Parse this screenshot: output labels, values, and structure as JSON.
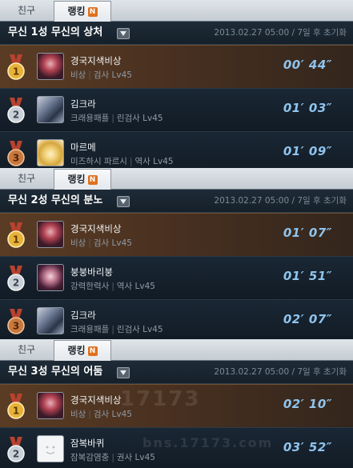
{
  "panels": [
    {
      "tabs": {
        "friend": "친구",
        "ranking": "랭킹",
        "badge": "N"
      },
      "title": "무신 1성 무신의 상처",
      "reset_info": "2013.02.27 05:00 / 7일 후 초기화",
      "rows": [
        {
          "rank": "1",
          "name": "경국지색비상",
          "guild": "비상",
          "cls": "검사 Lv45",
          "time": "00′ 44″"
        },
        {
          "rank": "2",
          "name": "김크라",
          "guild": "크래용패플",
          "cls": "린검사 Lv45",
          "time": "01′ 03″"
        },
        {
          "rank": "3",
          "name": "마르메",
          "guild": "미즈하시 파르시",
          "cls": "역사 Lv45",
          "time": "01′ 09″"
        }
      ]
    },
    {
      "tabs": {
        "friend": "친구",
        "ranking": "랭킹",
        "badge": "N"
      },
      "title": "무신 2성 무신의 분노",
      "reset_info": "2013.02.27 05:00 / 7일 후 초기화",
      "rows": [
        {
          "rank": "1",
          "name": "경국지색비상",
          "guild": "비상",
          "cls": "검사 Lv45",
          "time": "01′ 07″"
        },
        {
          "rank": "2",
          "name": "붕붕바리붕",
          "guild": "강력한력사",
          "cls": "역사 Lv45",
          "time": "01′ 51″"
        },
        {
          "rank": "3",
          "name": "김크라",
          "guild": "크래용패플",
          "cls": "린검사 Lv45",
          "time": "02′ 07″"
        }
      ]
    },
    {
      "tabs": {
        "friend": "친구",
        "ranking": "랭킹",
        "badge": "N"
      },
      "title": "무신 3성 무신의 어둠",
      "reset_info": "2013.02.27 05:00 / 7일 후 초기화",
      "rows": [
        {
          "rank": "1",
          "name": "경국지색비상",
          "guild": "비상",
          "cls": "검사 Lv45",
          "time": "02′ 10″"
        },
        {
          "rank": "2",
          "name": "잠복바퀴",
          "guild": "잠복감염충",
          "cls": "권사 Lv45",
          "time": "03′ 52″"
        }
      ]
    }
  ],
  "watermark": {
    "line1": "17173",
    "line2": "bns.17173.com"
  },
  "colors": {
    "gold": "#e8b23a",
    "silver": "#c9d0d6",
    "bronze": "#c9783c",
    "time": "#8fc4ee",
    "badge": "#e0701e"
  },
  "icons": {
    "medal": "medal-icon",
    "dropdown": "dropdown-arrow-icon"
  }
}
